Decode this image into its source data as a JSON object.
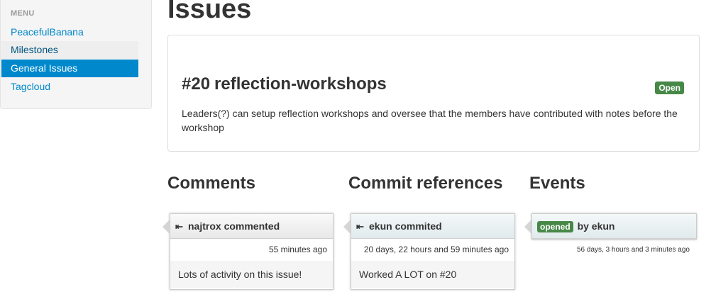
{
  "sidebar": {
    "header": "MENU",
    "items": [
      {
        "label": "PeacefulBanana"
      },
      {
        "label": "Milestones"
      },
      {
        "label": "General Issues"
      },
      {
        "label": "Tagcloud"
      }
    ]
  },
  "page": {
    "title": "Issues"
  },
  "issue": {
    "number": "#20",
    "title": "reflection-workshops",
    "status": "Open",
    "description": "Leaders(?) can setup reflection workshops and oversee that the members have contributed with notes before the workshop"
  },
  "sections": {
    "comments": "Comments",
    "commits": "Commit references",
    "events": "Events"
  },
  "comments": [
    {
      "header": "najtrox commented",
      "time": "55 minutes ago",
      "body": "Lots of activity on this issue!"
    }
  ],
  "commits": [
    {
      "header": "ekun commited",
      "time": "20 days, 22 hours and 59 minutes ago",
      "body": "Worked A LOT on #20"
    }
  ],
  "events": [
    {
      "badge": "opened",
      "actor": "by ekun",
      "time": "56 days, 3 hours and 3 minutes ago"
    }
  ],
  "colors": {
    "link": "#0088cc",
    "success": "#468847"
  },
  "icons": {
    "expand": "arrow-left-bar-icon"
  }
}
